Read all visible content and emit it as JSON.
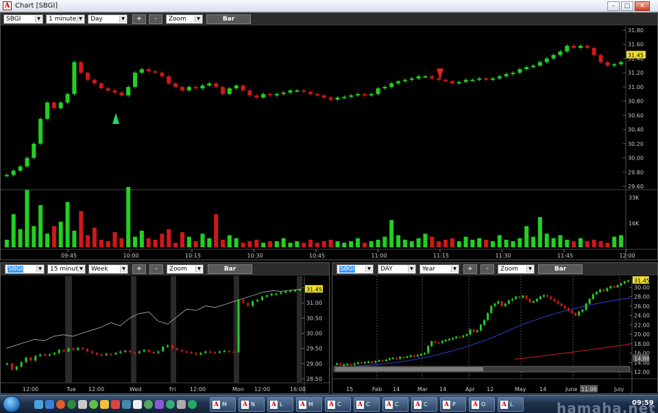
{
  "window": {
    "title": "Chart [SBGI]",
    "logo": "A",
    "min_label": "–",
    "max_label": "□",
    "close_label": "✕"
  },
  "main": {
    "symbol": "SBGI",
    "interval": "1 minute",
    "range": "Day",
    "plus_label": "+",
    "minus_label": "-",
    "zoom": "Zoom",
    "style_label": "Bar",
    "last_price": "31.45",
    "price_ticks": [
      "31.80",
      "31.60",
      "31.40",
      "31.20",
      "31.00",
      "30.80",
      "30.60",
      "30.40",
      "30.20",
      "30.00",
      "29.80",
      "29.60"
    ],
    "volume_ticks": [
      "33K",
      "16K"
    ],
    "time_labels": [
      "09:45",
      "10:00",
      "10:15",
      "10:30",
      "10:45",
      "11:00",
      "11:15",
      "11:30",
      "11:45",
      "12:00"
    ]
  },
  "left": {
    "symbol": "SBGI",
    "interval": "15 minutes",
    "range": "Week",
    "plus_label": "+",
    "minus_label": "-",
    "zoom": "Zoom",
    "style_label": "Bar",
    "last_price": "31.45",
    "price_ticks": [
      "31.50",
      "31.00",
      "30.50",
      "30.00",
      "29.50",
      "29.00",
      "28.50"
    ],
    "time_labels": [
      "12:00",
      "Tue",
      "12:00",
      "Wed",
      "Fri",
      "12:00",
      "Mon",
      "12:00",
      "16:00"
    ]
  },
  "right": {
    "symbol": "SBGI",
    "interval": "DAY",
    "range": "Year",
    "plus_label": "+",
    "minus_label": "-",
    "zoom": "Zoom",
    "style_label": "Bar",
    "last_price": "31.45",
    "ma_label": "14.88",
    "cursor_label": "11.06",
    "price_ticks": [
      "30.00",
      "28.00",
      "26.00",
      "24.00",
      "22.00",
      "20.00",
      "18.00",
      "16.00",
      "14.00",
      "12.00"
    ],
    "time_labels": [
      "15",
      "Feb",
      "14",
      "Mar",
      "14",
      "Apr",
      "12",
      "May",
      "14",
      "June",
      "July"
    ]
  },
  "taskbar": {
    "clock": "09:59",
    "items": [
      {
        "label": "M"
      },
      {
        "label": "N"
      },
      {
        "label": "L"
      },
      {
        "label": "M"
      },
      {
        "label": "C"
      },
      {
        "label": "C"
      },
      {
        "label": "C"
      },
      {
        "label": "C"
      },
      {
        "label": "P"
      },
      {
        "label": "O"
      },
      {
        "label": "L"
      }
    ]
  },
  "watermark": "hamaha.net",
  "colors": {
    "up": "#22d022",
    "down": "#d01818",
    "accent": "#f0e030"
  },
  "chart_data": [
    {
      "type": "candlestick",
      "title": "SBGI 1 minute",
      "categories_start": "09:37",
      "ylim": [
        29.6,
        31.8
      ],
      "close": [
        29.76,
        29.82,
        29.88,
        30.0,
        30.2,
        30.55,
        30.78,
        30.7,
        30.78,
        30.9,
        31.35,
        31.2,
        31.1,
        31.05,
        30.98,
        30.95,
        30.92,
        30.88,
        31.0,
        31.2,
        31.25,
        31.22,
        31.2,
        31.15,
        31.05,
        31.0,
        30.95,
        31.0,
        30.98,
        31.02,
        31.05,
        31.0,
        30.9,
        30.98,
        31.02,
        30.95,
        30.88,
        30.85,
        30.9,
        30.88,
        30.9,
        30.92,
        30.95,
        30.95,
        30.93,
        30.9,
        30.88,
        30.85,
        30.82,
        30.85,
        30.86,
        30.88,
        30.9,
        30.88,
        30.9,
        30.98,
        31.0,
        31.05,
        31.08,
        31.1,
        31.12,
        31.15,
        31.15,
        31.12,
        31.1,
        31.08,
        31.05,
        31.07,
        31.1,
        31.1,
        31.12,
        31.1,
        31.12,
        31.15,
        31.18,
        31.2,
        31.25,
        31.28,
        31.3,
        31.35,
        31.4,
        31.45,
        31.5,
        31.58,
        31.55,
        31.58,
        31.55,
        31.45,
        31.35,
        31.3,
        31.32,
        31.35
      ],
      "volume_max": 40000,
      "volume": [
        5000,
        22000,
        12000,
        38000,
        14000,
        28000,
        9000,
        14000,
        17000,
        30000,
        11000,
        24000,
        8000,
        13000,
        5000,
        4000,
        10000,
        6000,
        40000,
        7000,
        11000,
        6000,
        5000,
        9000,
        12000,
        3000,
        10000,
        7000,
        4000,
        9000,
        6000,
        22000,
        5000,
        8000,
        6000,
        3000,
        4000,
        5000,
        3000,
        4000,
        4000,
        6000,
        3000,
        4000,
        3000,
        5000,
        3000,
        4000,
        5000,
        4000,
        3000,
        4000,
        6000,
        3000,
        4000,
        5000,
        7000,
        18000,
        8000,
        5000,
        4000,
        6000,
        9000,
        7000,
        4000,
        5000,
        6000,
        4000,
        7000,
        5000,
        6000,
        5000,
        4000,
        8000,
        5000,
        4000,
        6000,
        14000,
        7000,
        20000,
        9000,
        6000,
        8000,
        5000,
        4000,
        6000,
        4000,
        5000,
        4000,
        3000,
        7000,
        8000
      ]
    },
    {
      "type": "candlestick",
      "title": "SBGI 15 minutes",
      "ylim": [
        28.5,
        31.75
      ],
      "close": [
        29.0,
        28.8,
        28.9,
        29.05,
        29.2,
        29.1,
        29.25,
        29.3,
        29.28,
        29.3,
        29.35,
        29.45,
        29.4,
        29.5,
        29.45,
        29.52,
        29.48,
        29.4,
        29.35,
        29.3,
        29.28,
        29.32,
        29.3,
        29.35,
        29.4,
        29.42,
        29.38,
        29.35,
        29.4,
        29.45,
        29.38,
        29.35,
        29.4,
        29.55,
        29.6,
        29.5,
        29.45,
        29.4,
        29.38,
        29.35,
        29.3,
        29.35,
        29.4,
        29.38,
        29.36,
        29.4,
        29.42,
        29.4,
        29.38,
        31.1,
        31.0,
        30.9,
        31.05,
        31.1,
        31.2,
        31.25,
        31.3,
        31.3,
        31.35,
        31.38,
        31.4,
        31.42,
        31.45
      ],
      "line_label": "",
      "line": [
        29.5,
        29.6,
        29.7,
        29.8,
        29.75,
        29.9,
        29.95,
        29.9,
        30.0,
        30.1,
        30.2,
        30.35,
        30.25,
        30.5,
        30.65,
        30.7,
        30.4,
        30.3,
        30.55,
        30.8,
        30.75,
        30.9,
        30.85,
        30.95,
        31.05,
        31.15,
        31.25,
        31.35,
        31.4,
        31.38,
        31.42,
        31.45
      ]
    },
    {
      "type": "candlestick",
      "title": "SBGI DAY",
      "ylim": [
        11.0,
        31.5
      ],
      "close": [
        13.8,
        13.5,
        13.6,
        13.7,
        13.5,
        13.8,
        14.0,
        13.9,
        14.1,
        14.2,
        14.0,
        14.3,
        14.5,
        14.4,
        14.6,
        14.9,
        15.0,
        14.8,
        15.2,
        15.1,
        15.3,
        15.5,
        15.4,
        15.6,
        15.8,
        16.0,
        17.5,
        18.5,
        18.3,
        18.2,
        18.6,
        18.8,
        19.0,
        19.2,
        19.5,
        19.4,
        19.7,
        20.0,
        21.0,
        20.5,
        20.8,
        22.0,
        23.0,
        24.5,
        26.0,
        26.5,
        27.0,
        26.0,
        26.5,
        27.2,
        27.5,
        28.0,
        27.8,
        28.2,
        27.5,
        26.8,
        27.0,
        27.5,
        28.0,
        28.3,
        28.0,
        27.5,
        27.0,
        26.5,
        26.0,
        25.5,
        25.0,
        24.5,
        24.0,
        24.8,
        25.2,
        26.5,
        27.5,
        28.5,
        29.0,
        29.5,
        29.2,
        29.8,
        30.2,
        30.0,
        30.4,
        30.8,
        31.2,
        31.45
      ],
      "ma_label": "",
      "ma": [
        13.0,
        13.1,
        13.2,
        13.35,
        13.5,
        13.7,
        13.9,
        14.2,
        14.5,
        14.9,
        15.3,
        15.8,
        16.3,
        16.9,
        17.5,
        18.2,
        18.9,
        19.7,
        20.6,
        21.5,
        22.3,
        23.0,
        23.7,
        24.3,
        24.9,
        25.4,
        25.9,
        26.3,
        26.7,
        27.1,
        27.4,
        27.7
      ],
      "ma2_label": "",
      "ma2": [
        14.7,
        16.2,
        17.9
      ]
    }
  ]
}
